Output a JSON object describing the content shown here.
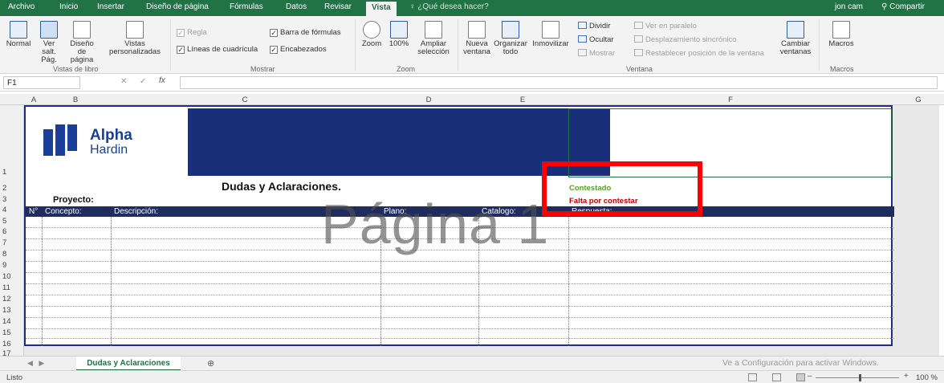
{
  "ribbon_tabs": [
    "Archivo",
    "Inicio",
    "Insertar",
    "Diseño de página",
    "Fórmulas",
    "Datos",
    "Revisar",
    "Vista"
  ],
  "tell_me": "¿Qué desea hacer?",
  "user": "jon cam",
  "share": "Compartir",
  "ribbon": {
    "workbook_views": {
      "normal": "Normal",
      "page_break": "Ver salt. Pág.",
      "page_layout": "Diseño de página",
      "custom": "Vistas personalizadas",
      "group": "Vistas de libro"
    },
    "show": {
      "ruler": "Regla",
      "formula_bar": "Barra de fórmulas",
      "gridlines": "Líneas de cuadrícula",
      "headings": "Encabezados",
      "group": "Mostrar"
    },
    "zoom": {
      "zoom": "Zoom",
      "p100": "100%",
      "selection": "Ampliar selección",
      "group": "Zoom"
    },
    "window": {
      "new": "Nueva ventana",
      "arrange": "Organizar todo",
      "freeze": "Inmovilizar",
      "split": "Dividir",
      "hide": "Ocultar",
      "unhide": "Mostrar",
      "side": "Ver en paralelo",
      "sync": "Desplazamiento sincrónico",
      "reset": "Restablecer posición de la ventana",
      "switch": "Cambiar ventanas",
      "group": "Ventana"
    },
    "macros": {
      "macros": "Macros",
      "group": "Macros"
    }
  },
  "formula_bar": {
    "name_box": "F1",
    "fx": "fx",
    "value": ""
  },
  "columns": [
    "A",
    "B",
    "C",
    "D",
    "E",
    "F",
    "G"
  ],
  "rows": [
    "1",
    "2",
    "3",
    "4",
    "5",
    "6",
    "7",
    "8",
    "9",
    "10",
    "11",
    "12",
    "13",
    "14",
    "15",
    "16",
    "17"
  ],
  "sheet": {
    "brand_line1": "Alpha",
    "brand_line2": "Hardin",
    "title": "Dudas y Aclaraciones.",
    "project_label": "Proyecto:",
    "legend_answered": "Contestado",
    "legend_pending": "Falta por contestar",
    "headers": {
      "num": "N°",
      "concept": "Concepto:",
      "desc": "Descripción:",
      "plan": "Plano:",
      "catalog": "Catalogo:",
      "answer": "Respuesta:"
    },
    "page_watermark": "Página 1"
  },
  "sheet_tab": "Dudas y Aclaraciones",
  "watermark_activate": "Ve a Configuración para activar Windows.",
  "status": {
    "ready": "Listo",
    "zoom": "100 %"
  },
  "colors": {
    "excel_green": "#217346",
    "banner_blue": "#1a2f7a",
    "answered": "#5aa02c",
    "pending": "#c00000",
    "highlight": "#ff0000"
  }
}
